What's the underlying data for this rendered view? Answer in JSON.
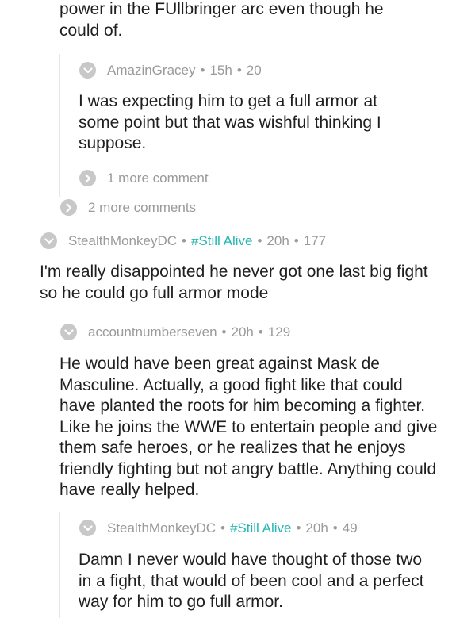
{
  "comments": [
    {
      "id": "c0",
      "text": "power in the FUllbringer arc even though he could of."
    },
    {
      "id": "c1",
      "author": "AmazinGracey",
      "age": "15h",
      "score": "20",
      "text": "I was expecting him to get a full armor at some point but that was wishful thinking I suppose."
    },
    {
      "id": "c2",
      "author": "StealthMonkeyDC",
      "flair": "#Still Alive",
      "age": "20h",
      "score": "177",
      "text": "I'm really disappointed he never got one last big fight so he could go full armor mode"
    },
    {
      "id": "c3",
      "author": "accountnumberseven",
      "age": "20h",
      "score": "129",
      "text": "He would have been great against Mask de Masculine. Actually, a good fight like that could have planted the roots for him becoming a fighter. Like he joins the WWE to entertain people and give them safe heroes, or he realizes that he enjoys friendly fighting but not angry battle. Anything could have really helped."
    },
    {
      "id": "c4",
      "author": "StealthMonkeyDC",
      "flair": "#Still Alive",
      "age": "20h",
      "score": "49",
      "text": "Damn I never would have thought of those two in a fight, that would of been cool and a perfect way for him to go full armor."
    }
  ],
  "more": {
    "one": "1 more comment",
    "two": "2 more comments"
  },
  "separator": "•",
  "icons": {
    "collapse": "chevron-down-icon",
    "expand": "chevron-right-icon"
  },
  "colors": {
    "flair": "#25b7b0",
    "meta": "#9a9a9a",
    "icon": "#c8c8c8",
    "thread_line": "#e6e6e6"
  }
}
